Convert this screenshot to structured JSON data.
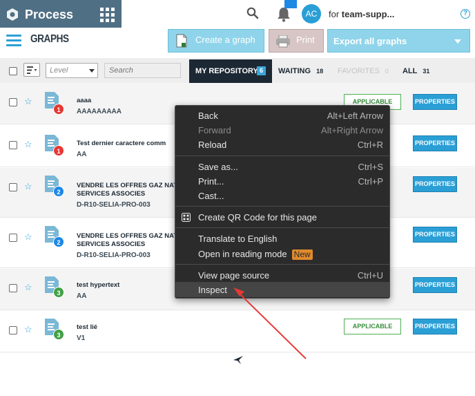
{
  "app": {
    "name": "Process",
    "avatar_initials": "AC",
    "org_prefix": "for ",
    "org_name": "team-supp...",
    "help_glyph": "?"
  },
  "page": {
    "title": "GRAPHS"
  },
  "toolbar": {
    "create_label": "Create a graph",
    "print_label": "Print",
    "export_label": "Export all graphs"
  },
  "filters": {
    "level_value": "Level",
    "search_placeholder": "Search"
  },
  "tabs": [
    {
      "label": "MY REPOSITORY",
      "count": "6",
      "active": true
    },
    {
      "label": "WAITING",
      "count": "18"
    },
    {
      "label": "FAVORITES",
      "count": "0",
      "disabled": true
    },
    {
      "label": "ALL",
      "count": "31"
    }
  ],
  "rows": [
    {
      "title_lines": [
        "aaaa",
        ""
      ],
      "code": "AAAAAAAAA",
      "version": "1",
      "version_color": "#e53935",
      "status": "APPLICABLE",
      "props": "PROPERTIES"
    },
    {
      "title_lines": [
        "Test dernier caractere comm",
        ""
      ],
      "code": "AA",
      "version": "1",
      "version_color": "#e53935",
      "status": "",
      "props": "PROPERTIES"
    },
    {
      "title_lines": [
        "VENDRE LES OFFRES GAZ NATU",
        "SERVICES ASSOCIES"
      ],
      "code": "D-R10-SELIA-PRO-003",
      "version": "2",
      "version_color": "#1e88e5",
      "status": "",
      "props": "PROPERTIES"
    },
    {
      "title_lines": [
        "VENDRE LES OFFRES GAZ NATU",
        "SERVICES ASSOCIES"
      ],
      "code": "D-R10-SELIA-PRO-003",
      "version": "2",
      "version_color": "#1e88e5",
      "status": "",
      "props": "PROPERTIES"
    },
    {
      "title_lines": [
        "test hypertext",
        ""
      ],
      "code": "AA",
      "version": "3",
      "version_color": "#43a047",
      "status": "",
      "props": "PROPERTIES"
    },
    {
      "title_lines": [
        "test lié",
        ""
      ],
      "code": "V1",
      "version": "3",
      "version_color": "#43a047",
      "status": "APPLICABLE",
      "props": "PROPERTIES"
    }
  ],
  "context_menu": {
    "back": {
      "label": "Back",
      "shortcut": "Alt+Left Arrow"
    },
    "forward": {
      "label": "Forward",
      "shortcut": "Alt+Right Arrow"
    },
    "reload": {
      "label": "Reload",
      "shortcut": "Ctrl+R"
    },
    "save_as": {
      "label": "Save as...",
      "shortcut": "Ctrl+S"
    },
    "print": {
      "label": "Print...",
      "shortcut": "Ctrl+P"
    },
    "cast": {
      "label": "Cast..."
    },
    "qr": {
      "label": "Create QR Code for this page"
    },
    "translate": {
      "label": "Translate to English"
    },
    "reading": {
      "label": "Open in reading mode",
      "badge": "New"
    },
    "view_source": {
      "label": "View page source",
      "shortcut": "Ctrl+U"
    },
    "inspect": {
      "label": "Inspect"
    }
  },
  "colors": {
    "accent": "#2a9fd6",
    "brand_bar": "#4f6f84",
    "annotation_arrow": "#e53935",
    "menu_bg": "#2b2b2b"
  },
  "icons": [
    "process-logo-icon",
    "app-grid-icon",
    "search-icon",
    "bell-icon",
    "hamburger-menu-icon",
    "document-add-icon",
    "printer-icon",
    "chevron-down-icon",
    "sort-icon",
    "star-icon",
    "graph-document-icon",
    "qr-code-icon",
    "red-annotation-arrow"
  ]
}
